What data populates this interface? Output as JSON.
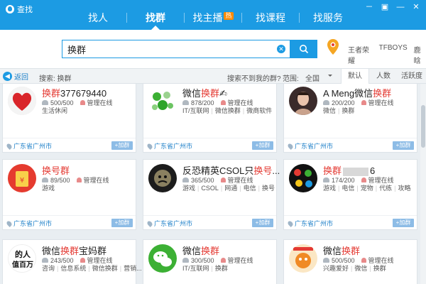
{
  "window": {
    "title": "查找",
    "controls": [
      "－",
      "▣",
      "—",
      "✕"
    ]
  },
  "nav": {
    "items": [
      {
        "label": "找人"
      },
      {
        "label": "找群"
      },
      {
        "label": "找主播"
      },
      {
        "label": "找课程"
      },
      {
        "label": "找服务"
      }
    ],
    "active": "找群",
    "hot_badge": "热"
  },
  "search": {
    "value": "换群",
    "hot_words": [
      "王者荣耀",
      "TFBOYS",
      "鹿晗"
    ]
  },
  "filter": {
    "back_label": "返回",
    "search_label": "搜索: 换群",
    "not_found_label": "搜索不到我的群?",
    "range_label": "范围:",
    "range_value": "全国",
    "sort_tabs": [
      "默认",
      "人数",
      "活跃度"
    ],
    "active_sort": "默认"
  },
  "cards": [
    {
      "name_pre": "",
      "name_hl": "换群",
      "name_post": "377679440",
      "members": "500/500",
      "admin": "管理在线",
      "tags": [
        "生活休闲"
      ],
      "location": "广东省广州市",
      "join": "+加群"
    },
    {
      "name_pre": "微信",
      "name_hl": "换群",
      "name_post": "✍",
      "members": "878/200",
      "admin": "管理在线",
      "tags": [
        "IT/互联网",
        "微信换群",
        "微商软件"
      ],
      "location": "广东省广州市",
      "join": "+加群"
    },
    {
      "name_pre": "A Meng微信",
      "name_hl": "换群",
      "name_post": "",
      "members": "200/200",
      "admin": "管理在线",
      "tags": [
        "微信",
        "换群"
      ],
      "location": "广东省广州市",
      "join": "+加群"
    },
    {
      "name_pre": "",
      "name_hl": "换号群",
      "name_post": "",
      "members": "89/500",
      "admin": "管理在线",
      "tags": [
        "游戏"
      ],
      "location": "广东省广州市",
      "join": "+加群"
    },
    {
      "name_pre": "反恐精英CSOL只",
      "name_hl": "换号",
      "name_post": "...",
      "members": "365/500",
      "admin": "管理在线",
      "tags": [
        "游戏",
        "CSOL",
        "网通",
        "电信",
        "换号"
      ],
      "location": "广东省广州市",
      "join": "+加群"
    },
    {
      "name_pre": "",
      "name_hl": "换群",
      "name_post": "6",
      "members": "174/200",
      "admin": "管理在线",
      "tags": [
        "游戏",
        "电信",
        "宠物",
        "代练",
        "攻略"
      ],
      "location": "广东省广州市",
      "join": "+加群"
    },
    {
      "name_pre": "微信",
      "name_hl": "换群",
      "name_post": "宝妈群",
      "members": "243/500",
      "admin": "管理在线",
      "tags": [
        "咨询",
        "信息系统",
        "微信换群",
        "营销..."
      ],
      "location": "",
      "join": ""
    },
    {
      "name_pre": "微信",
      "name_hl": "换群",
      "name_post": "",
      "members": "300/500",
      "admin": "管理在线",
      "tags": [
        "IT/互联网",
        "换群"
      ],
      "location": "",
      "join": ""
    },
    {
      "name_pre": "微信",
      "name_hl": "换群",
      "name_post": "",
      "members": "500/500",
      "admin": "管理在线",
      "tags": [
        "兴趣爱好",
        "微信",
        "换群"
      ],
      "location": "",
      "join": ""
    }
  ],
  "avatar_text": {
    "card7": [
      "的人",
      "值百万"
    ]
  },
  "colors": {
    "accent": "#1c9be3",
    "highlight": "#e43a33",
    "link": "#1c7fc8"
  }
}
